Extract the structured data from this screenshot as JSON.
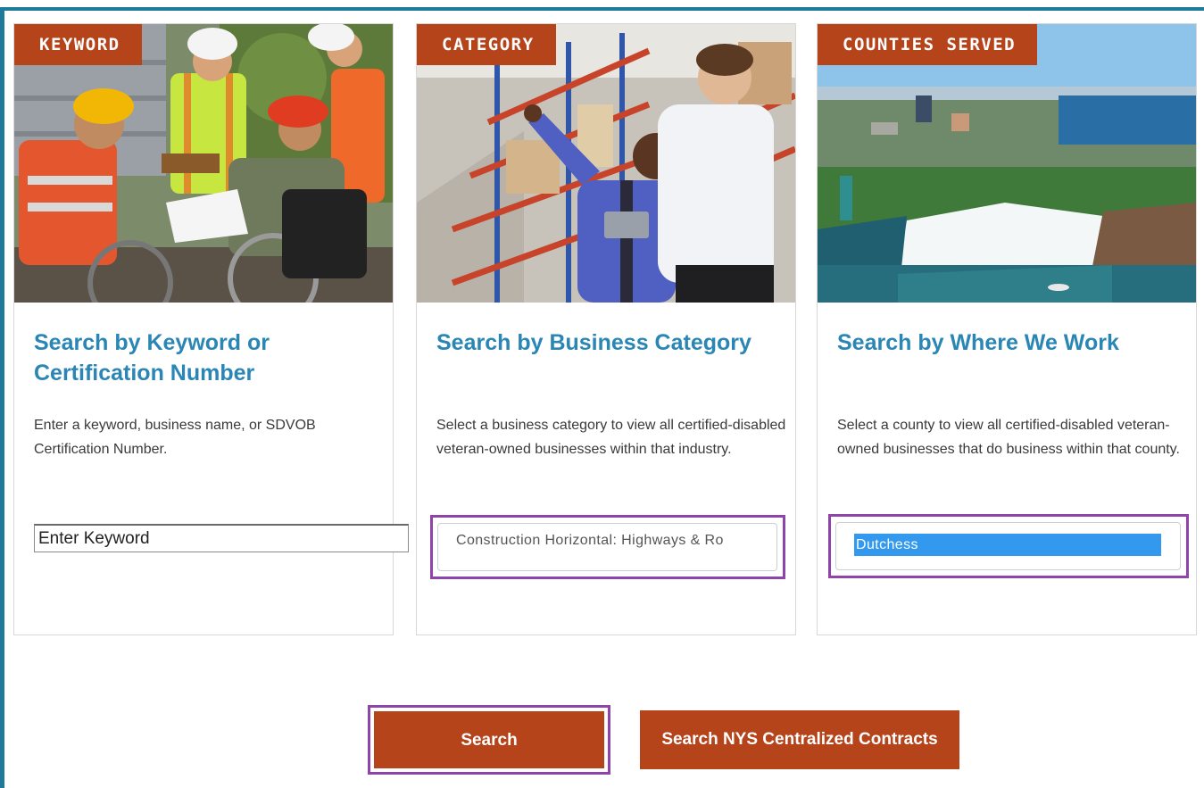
{
  "cards": [
    {
      "tag": "KEYWORD",
      "title": "Search by Keyword or Certification Number",
      "description": "Enter a keyword, business name, or SDVOB Certification Number.",
      "image": "construction-workers-photo",
      "input_placeholder": "Enter Keyword"
    },
    {
      "tag": "CATEGORY",
      "title": "Search by Business Category",
      "description": "Select a business category to view all certified-disabled veteran-owned businesses within that industry.",
      "image": "warehouse-photo",
      "select_value": "Construction Horizontal: Highways & Ro"
    },
    {
      "tag": "COUNTIES SERVED",
      "title": "Search by Where We Work",
      "description": "Select a county to view all certified-disabled veteran-owned businesses that do business within that county.",
      "image": "waterfall-aerial-photo",
      "select_value": "Dutchess"
    }
  ],
  "buttons": {
    "search": "Search",
    "contracts": "Search NYS Centralized Contracts"
  },
  "colors": {
    "accent": "#b5441b",
    "title_blue": "#2a86b4",
    "frame": "#1f7a9c",
    "highlight": "#8e44a8"
  }
}
